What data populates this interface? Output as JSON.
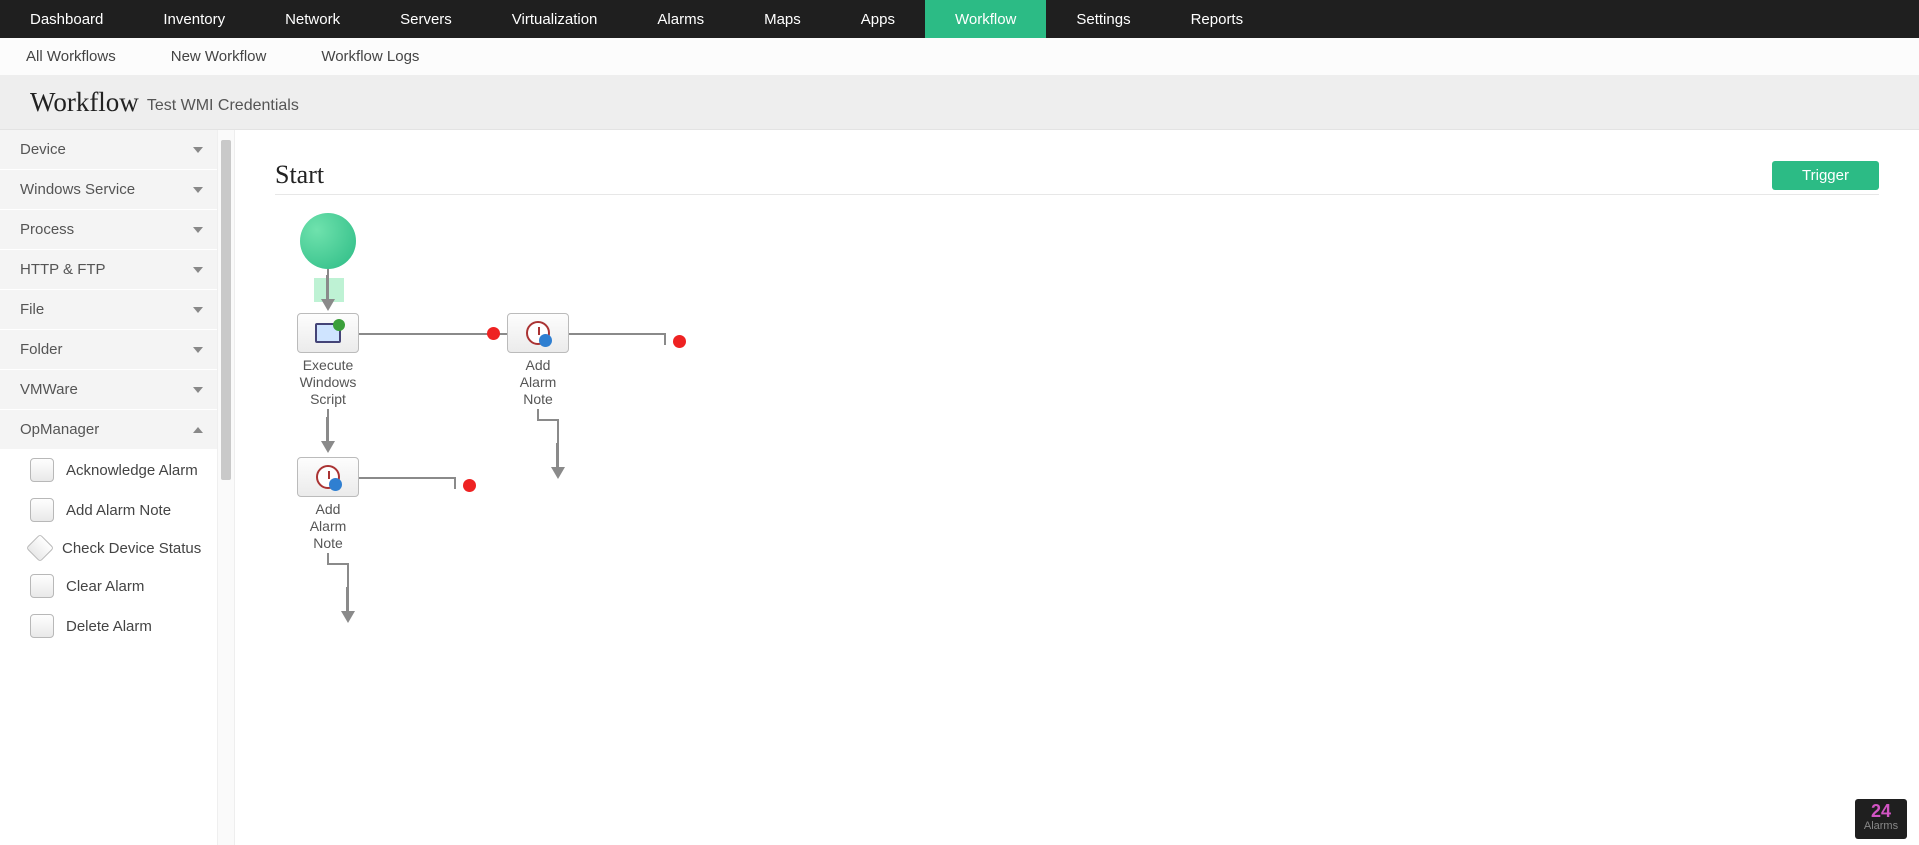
{
  "main_nav": {
    "items": [
      "Dashboard",
      "Inventory",
      "Network",
      "Servers",
      "Virtualization",
      "Alarms",
      "Maps",
      "Apps",
      "Workflow",
      "Settings",
      "Reports"
    ],
    "active": "Workflow"
  },
  "sub_nav": {
    "items": [
      "All Workflows",
      "New Workflow",
      "Workflow Logs"
    ]
  },
  "page": {
    "title": "Workflow",
    "subtitle": "Test WMI Credentials"
  },
  "sidebar": {
    "categories": [
      {
        "label": "Device",
        "expanded": false
      },
      {
        "label": "Windows Service",
        "expanded": false
      },
      {
        "label": "Process",
        "expanded": false
      },
      {
        "label": "HTTP & FTP",
        "expanded": false
      },
      {
        "label": "File",
        "expanded": false
      },
      {
        "label": "Folder",
        "expanded": false
      },
      {
        "label": "VMWare",
        "expanded": false
      },
      {
        "label": "OpManager",
        "expanded": true
      }
    ],
    "opmanager_tasks": [
      {
        "label": "Acknowledge Alarm",
        "shape": "rect"
      },
      {
        "label": "Add Alarm Note",
        "shape": "rect"
      },
      {
        "label": "Check Device Status",
        "shape": "diamond"
      },
      {
        "label": "Clear Alarm",
        "shape": "rect"
      },
      {
        "label": "Delete Alarm",
        "shape": "rect"
      }
    ]
  },
  "canvas": {
    "start_heading": "Start",
    "trigger_label": "Trigger",
    "nodes": {
      "n1": {
        "lines": [
          "Execute",
          "Windows",
          "Script"
        ]
      },
      "n2": {
        "lines": [
          "Add",
          "Alarm",
          "Note"
        ]
      },
      "n3": {
        "lines": [
          "Add",
          "Alarm",
          "Note"
        ]
      }
    }
  },
  "alarm_badge": {
    "count": "24",
    "label": "Alarms"
  }
}
